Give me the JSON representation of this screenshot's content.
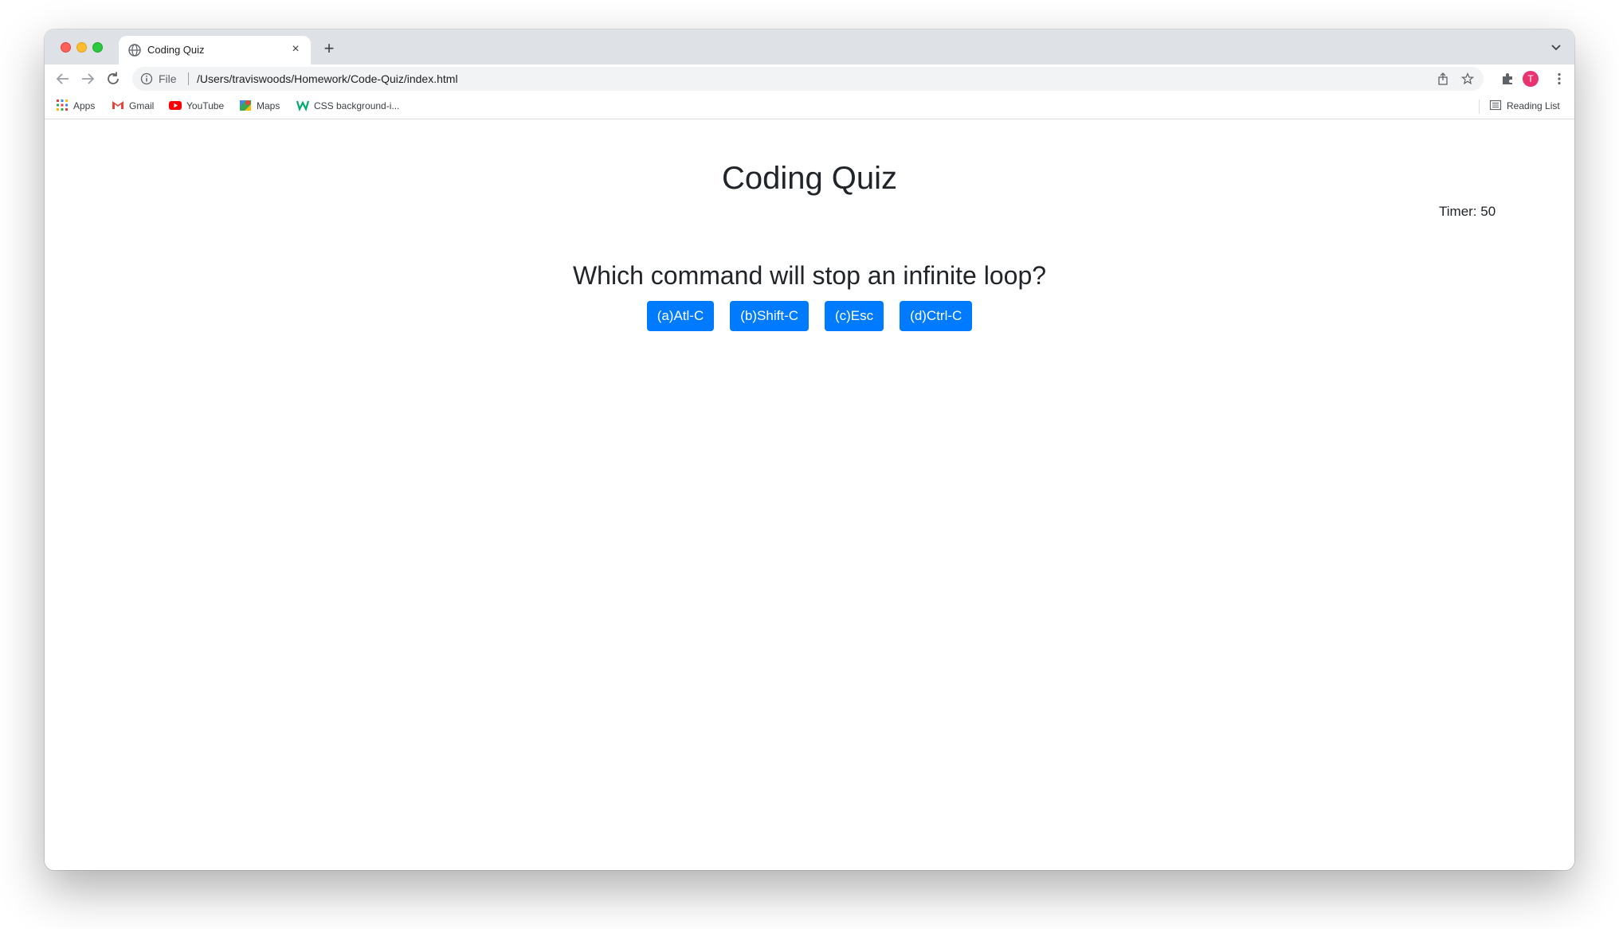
{
  "browser": {
    "tab": {
      "title": "Coding Quiz",
      "close_glyph": "×"
    },
    "new_tab_glyph": "+",
    "omnibox": {
      "scheme_label": "File",
      "url": "/Users/traviswoods/Homework/Code-Quiz/index.html"
    },
    "profile_initial": "T",
    "bookmarks": [
      {
        "label": "Apps",
        "icon": "apps-grid-icon"
      },
      {
        "label": "Gmail",
        "icon": "gmail-icon"
      },
      {
        "label": "YouTube",
        "icon": "youtube-icon"
      },
      {
        "label": "Maps",
        "icon": "maps-icon"
      },
      {
        "label": "CSS background-i...",
        "icon": "w3schools-icon"
      }
    ],
    "reading_list_label": "Reading List",
    "colors": {
      "tabstrip": "#dee1e6",
      "omnibox": "#f1f3f4",
      "avatar": "#e8336e"
    }
  },
  "quiz": {
    "title": "Coding Quiz",
    "timer_text": "Timer: 50",
    "question": "Which command will stop an infinite loop?",
    "answers": [
      "(a)Atl-C",
      "(b)Shift-C",
      "(c)Esc",
      "(d)Ctrl-C"
    ],
    "button_color": "#007bff"
  }
}
